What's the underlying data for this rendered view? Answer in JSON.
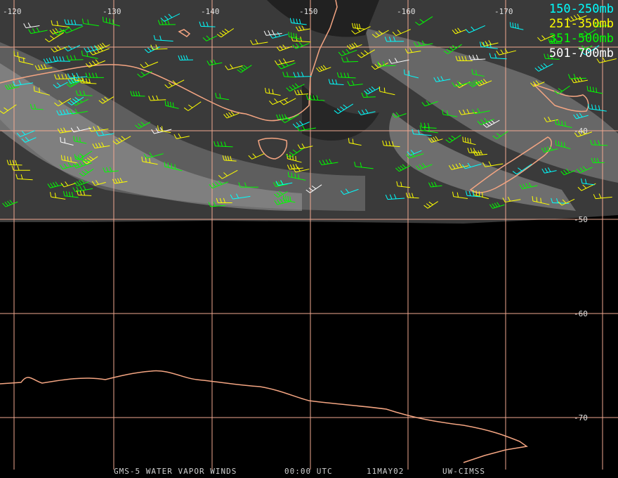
{
  "map": {
    "longitude_labels": [
      "-120",
      "-130",
      "-140",
      "-150",
      "-160",
      "-170"
    ],
    "latitude_labels": [
      "-40",
      "-50",
      "-60",
      "-70"
    ],
    "grid_color": "#f0a890",
    "coastline_color": "#f4a582"
  },
  "legend": [
    {
      "label": "150-250mb",
      "color": "#00ffff"
    },
    {
      "label": "251-350mb",
      "color": "#ffff00"
    },
    {
      "label": "351-500mb",
      "color": "#00ff00"
    },
    {
      "label": "501-700mb",
      "color": "#ffffff"
    }
  ],
  "footer": {
    "product": "GMS-5 WATER VAPOR WINDS",
    "time": "00:00 UTC",
    "date": "11MAY02",
    "source": "UW-CIMSS"
  }
}
